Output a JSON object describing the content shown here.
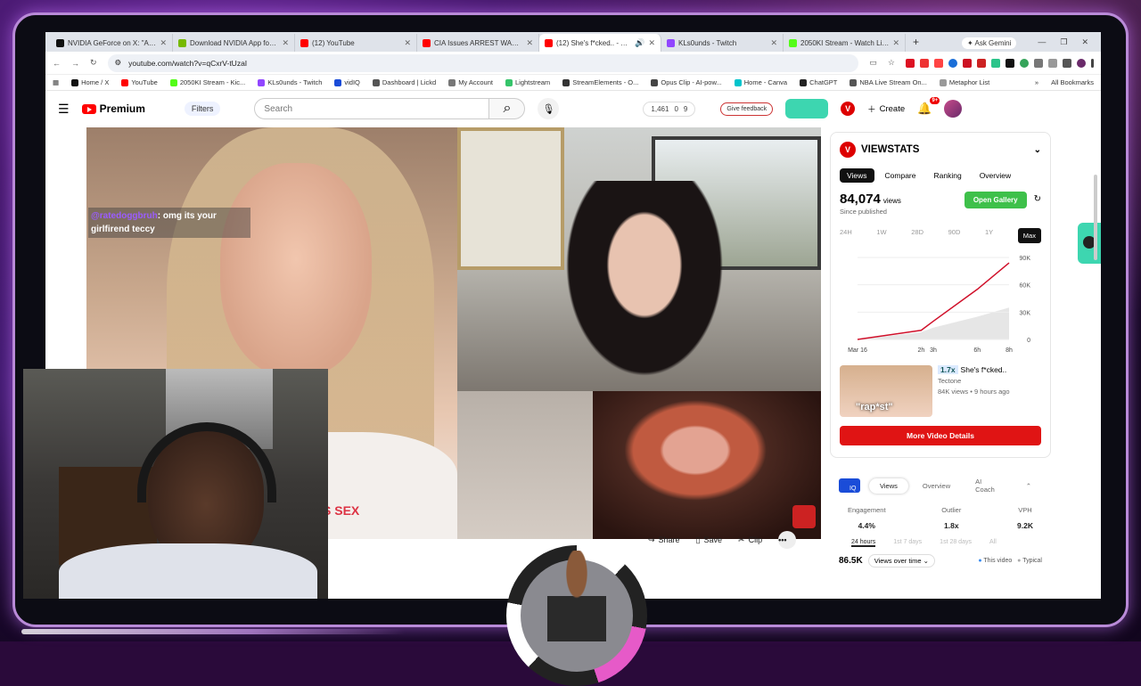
{
  "browser": {
    "tabs": [
      {
        "label": "NVIDIA GeForce on X: \"Anno",
        "color": "#111111"
      },
      {
        "label": "Download NVIDIA App for G",
        "color": "#76b900"
      },
      {
        "label": "(12) YouTube",
        "color": "#ff0000"
      },
      {
        "label": "CIA Issues ARREST WARRAN",
        "color": "#ff0000"
      },
      {
        "label": "(12) She's f*cked.. - You",
        "color": "#ff0000",
        "active": true
      },
      {
        "label": "KLs0unds - Twitch",
        "color": "#9146ff"
      },
      {
        "label": "2050KI Stream - Watch Live",
        "color": "#53fc18"
      }
    ],
    "new_tab": "+",
    "ask_gemini": "✦ Ask Gemini",
    "url": "youtube.com/watch?v=qCxrV-tUzaI",
    "bookmarks": [
      {
        "label": "Home / X",
        "color": "#111111"
      },
      {
        "label": "YouTube",
        "color": "#ff0000"
      },
      {
        "label": "2050KI Stream - Kic...",
        "color": "#53fc18"
      },
      {
        "label": "KLs0unds - Twitch",
        "color": "#9146ff"
      },
      {
        "label": "vidIQ",
        "color": "#1a4cd8"
      },
      {
        "label": "Dashboard | Lickd",
        "color": "#555555"
      },
      {
        "label": "My Account",
        "color": "#777777"
      },
      {
        "label": "Lightstream",
        "color": "#35c46a"
      },
      {
        "label": "StreamElements - O...",
        "color": "#333333"
      },
      {
        "label": "Opus Clip - AI-pow...",
        "color": "#444444"
      },
      {
        "label": "Home - Canva",
        "color": "#00c4cc"
      },
      {
        "label": "ChatGPT",
        "color": "#222222"
      },
      {
        "label": "NBA Live Stream On...",
        "color": "#555555"
      },
      {
        "label": "Metaphor List",
        "color": "#999999"
      }
    ],
    "all_bookmarks": "All Bookmarks"
  },
  "youtube": {
    "logo": "Premium",
    "filters": "Filters",
    "search_placeholder": "Search",
    "stats": {
      "views": "1,461",
      "a": "0",
      "b": "9"
    },
    "give_feedback": "Give feedback",
    "create": "Create",
    "notifications": "9+",
    "chat_user": "@ratedoggbruh",
    "chat_msg": ": omg its your girlfirend teccy",
    "shirt_text": "S SEX",
    "actions": {
      "share": "Share",
      "save": "Save",
      "clip": "Clip",
      "more": "•••"
    }
  },
  "viewstats": {
    "title": "VIEWSTATS",
    "tabs": [
      "Views",
      "Compare",
      "Ranking",
      "Overview"
    ],
    "views": "84,074",
    "views_unit": "views",
    "since": "Since published",
    "open_gallery": "Open Gallery",
    "ranges": [
      "24H",
      "1W",
      "28D",
      "90D",
      "1Y",
      "Max"
    ],
    "chart_y_labels": [
      "90K",
      "60K",
      "30K",
      "0"
    ],
    "chart_x_labels": [
      "Mar 16",
      "2h",
      "3h",
      "6h",
      "8h"
    ],
    "related": {
      "thumb_text": "\"rap*st\"",
      "multiplier": "1.7x",
      "title": "She's f*cked..",
      "channel": "Tectone",
      "meta": "84K views • 9 hours ago"
    },
    "more_details": "More Video Details"
  },
  "vidiq": {
    "logo": "IQ",
    "tabs": [
      "Views",
      "Overview",
      "AI Coach"
    ],
    "metrics": [
      {
        "label": "Engagement",
        "value": "4.4%"
      },
      {
        "label": "Outlier",
        "value": "1.8x"
      },
      {
        "label": "VPH",
        "value": "9.2K"
      }
    ],
    "ranges": [
      "24 hours",
      "1st 7 days",
      "1st 28 days",
      "All"
    ],
    "views": "86.5K",
    "select": "Views over time",
    "legend_this": "This video",
    "legend_typical": "Typical"
  },
  "chart_data": {
    "type": "line",
    "x": [
      "Mar 16",
      "2h",
      "3h",
      "6h",
      "8h"
    ],
    "series": [
      {
        "values": [
          0,
          10000,
          20000,
          55000,
          84074
        ],
        "color": "#d0102a"
      },
      {
        "values": [
          0,
          8000,
          13000,
          25000,
          35000
        ],
        "color": "#cccccc"
      }
    ],
    "ylim": [
      0,
      90000
    ],
    "y_ticks": [
      "90K",
      "60K",
      "30K",
      "0"
    ]
  }
}
